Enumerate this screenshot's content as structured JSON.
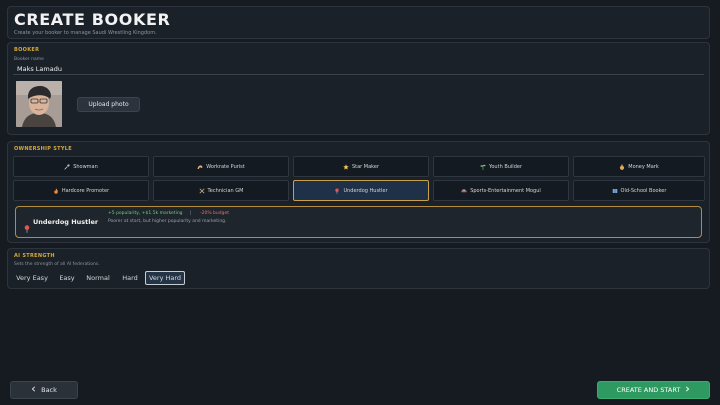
{
  "header": {
    "title": "CREATE BOOKER",
    "subtitle": "Create your booker to manage Saudi Wrestling Kingdom."
  },
  "booker": {
    "section_label": "BOOKER",
    "name_label": "Booker name",
    "name_value": "Maks Lamadu",
    "upload_label": "Upload photo"
  },
  "ownership": {
    "section_label": "OWNERSHIP STYLE",
    "options": [
      {
        "label": "Showman",
        "icon": "microphone-icon"
      },
      {
        "label": "Workrate Purist",
        "icon": "muscle-icon"
      },
      {
        "label": "Star Maker",
        "icon": "star-icon"
      },
      {
        "label": "Youth Builder",
        "icon": "sprout-icon"
      },
      {
        "label": "Money Mark",
        "icon": "money-bag-icon"
      },
      {
        "label": "Hardcore Promoter",
        "icon": "fire-icon"
      },
      {
        "label": "Technician GM",
        "icon": "tools-icon"
      },
      {
        "label": "Underdog Hustler",
        "icon": "pin-icon"
      },
      {
        "label": "Sports-Entertainment Mogul",
        "icon": "car-icon"
      },
      {
        "label": "Old-School Booker",
        "icon": "book-icon"
      }
    ],
    "selected_index": 7,
    "selected": {
      "title": "Underdog Hustler",
      "bonus": "+5 popularity, +$1.5k marketing",
      "separator": "|",
      "malus": "-20% budget",
      "description": "Poorer at start, but higher popularity and marketing."
    }
  },
  "ai_strength": {
    "section_label": "AI STRENGTH",
    "hint": "Sets the strength of all AI federations.",
    "options": [
      "Very Easy",
      "Easy",
      "Normal",
      "Hard",
      "Very Hard"
    ],
    "selected": "Very Hard"
  },
  "footer": {
    "back_label": "Back",
    "back_icon": "chevron-left-icon",
    "create_label": "CREATE AND START",
    "create_icon": "chevron-right-icon"
  },
  "colors": {
    "accent_gold": "#d6a93c",
    "create_green": "#2e9a62",
    "bonus_green": "#6fcf7a",
    "malus_red": "#e0736b",
    "selected_border": "#c9a04a"
  }
}
